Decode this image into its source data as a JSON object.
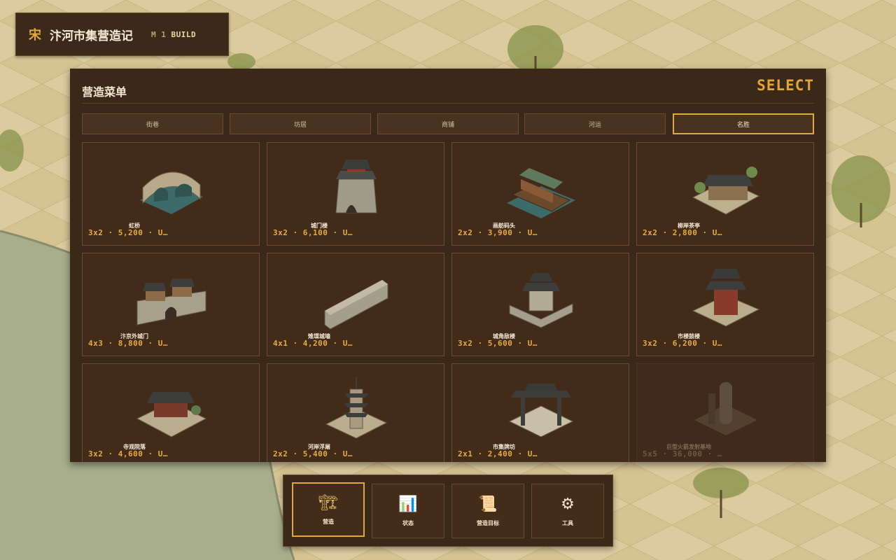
{
  "header": {
    "dynasty_mark": "宋",
    "city_title": "汴河市集营造记",
    "mode_prefix": "M 1",
    "mode_label": "BUILD"
  },
  "panel": {
    "title": "营造菜单",
    "select_label": "SELECT"
  },
  "tabs": [
    {
      "label": "街巷",
      "active": false
    },
    {
      "label": "坊居",
      "active": false
    },
    {
      "label": "商铺",
      "active": false
    },
    {
      "label": "河运",
      "active": false
    },
    {
      "label": "名胜",
      "active": true
    }
  ],
  "buildings": [
    {
      "name": "虹桥",
      "stats": "3x2 · 5,200 · U…",
      "icon": "arch-bridge-icon",
      "locked": false
    },
    {
      "name": "城门楼",
      "stats": "3x2 · 6,100 · U…",
      "icon": "gate-tower-icon",
      "locked": false
    },
    {
      "name": "画舫码头",
      "stats": "2x2 · 3,900 · U…",
      "icon": "pleasure-boat-pier-icon",
      "locked": false
    },
    {
      "name": "柳岸茶亭",
      "stats": "2x2 · 2,800 · U…",
      "icon": "tea-pavilion-icon",
      "locked": false
    },
    {
      "name": "汴京外城门",
      "stats": "4x3 · 8,800 · U…",
      "icon": "outer-city-gate-icon",
      "locked": false
    },
    {
      "name": "雉堞城墙",
      "stats": "4x1 · 4,200 · U…",
      "icon": "crenellated-wall-icon",
      "locked": false
    },
    {
      "name": "城角敌楼",
      "stats": "3x2 · 5,600 · U…",
      "icon": "corner-watchtower-icon",
      "locked": false
    },
    {
      "name": "市楼鼓楼",
      "stats": "3x2 · 6,200 · U…",
      "icon": "drum-tower-icon",
      "locked": false
    },
    {
      "name": "寺观院落",
      "stats": "3x2 · 4,600 · U…",
      "icon": "temple-courtyard-icon",
      "locked": false
    },
    {
      "name": "河岸浮屠",
      "stats": "2x2 · 5,400 · U…",
      "icon": "riverside-pagoda-icon",
      "locked": false
    },
    {
      "name": "市集牌坊",
      "stats": "2x1 · 2,400 · U…",
      "icon": "market-archway-icon",
      "locked": false
    },
    {
      "name": "巨型火箭发射基地",
      "stats": "5x5 · 36,000 · …",
      "icon": "rocket-launch-base-icon",
      "locked": true
    }
  ],
  "toolbar": [
    {
      "label": "营造",
      "icon": "crane-icon",
      "glyph": "🏗",
      "active": true
    },
    {
      "label": "状态",
      "icon": "bar-chart-icon",
      "glyph": "📊",
      "active": false
    },
    {
      "label": "营造目标",
      "icon": "scroll-icon",
      "glyph": "📜",
      "active": false
    },
    {
      "label": "工具",
      "icon": "gear-icon",
      "glyph": "⚙",
      "active": false
    }
  ]
}
